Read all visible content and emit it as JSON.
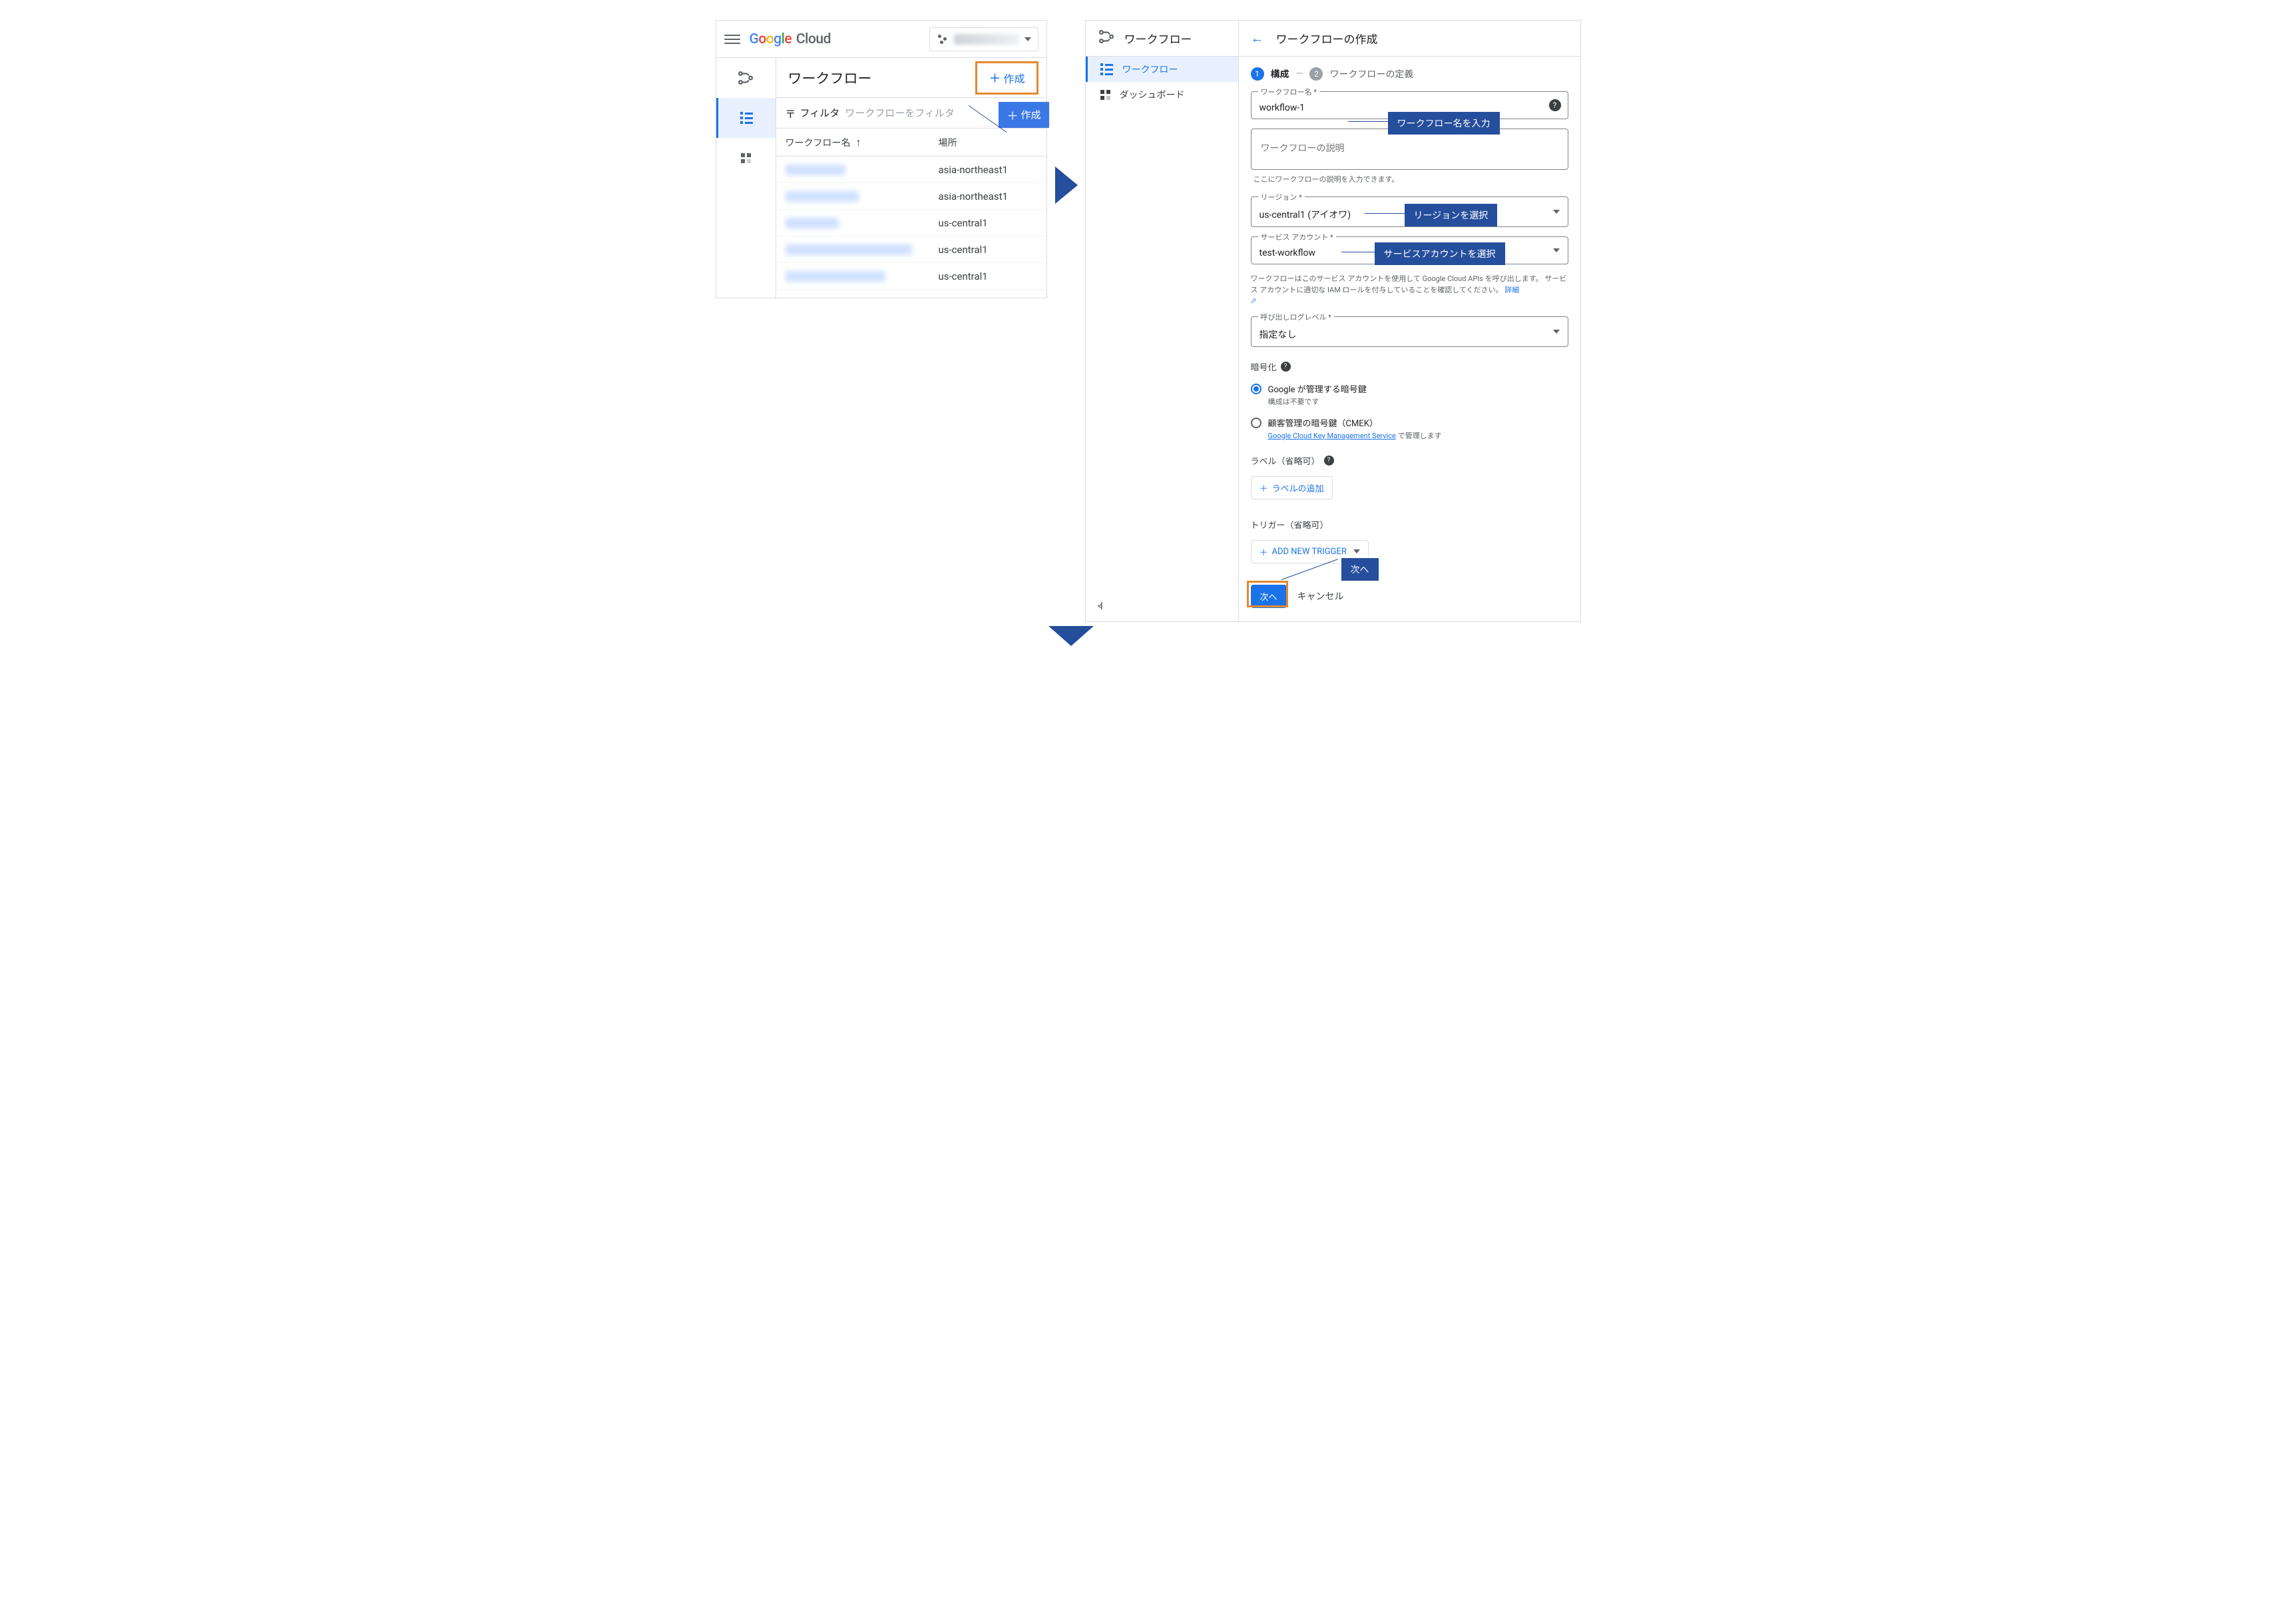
{
  "left": {
    "logoCloud": "Cloud",
    "title": "ワークフロー",
    "createLabel": "作成",
    "filterLabel": "フィルタ",
    "filterPlaceholder": "ワークフローをフィルタ",
    "tooltipCreate": "作成",
    "cols": {
      "name": "ワークフロー名",
      "loc": "場所"
    },
    "rows": [
      {
        "loc": "asia-northeast1"
      },
      {
        "loc": "asia-northeast1"
      },
      {
        "loc": "us-central1"
      },
      {
        "loc": "us-central1"
      },
      {
        "loc": "us-central1"
      }
    ]
  },
  "right": {
    "sideTitle": "ワークフロー",
    "nav": {
      "workflows": "ワークフロー",
      "dashboard": "ダッシュボード"
    },
    "headTitle": "ワークフローの作成",
    "step1": "構成",
    "step2": "ワークフローの定義",
    "fields": {
      "nameLegend": "ワークフロー名 *",
      "nameValue": "workflow-1",
      "descPlaceholder": "ワークフローの説明",
      "descHelper": "ここにワークフローの説明を入力できます。",
      "regionLegend": "リージョン *",
      "regionValue": "us-central1 (アイオワ)",
      "svcLegend": "サービス アカウント *",
      "svcValue": "test-workflow",
      "svcHelp1": "ワークフローはこのサービス アカウントを使用して Google Cloud APIs を呼び出します。",
      "svcHelp2": "サービス アカウントに適切な IAM ロールを付与していることを確認してください。",
      "svcDetail": "詳細",
      "logLegend": "呼び出しログレベル *",
      "logValue": "指定なし"
    },
    "enc": {
      "title": "暗号化",
      "opt1": "Google が管理する暗号鍵",
      "opt1sub": "構成は不要です",
      "opt2": "顧客管理の暗号鍵（CMEK）",
      "opt2link": "Google Cloud Key Management Service",
      "opt2tail": " で管理します"
    },
    "labelsTitle": "ラベル（省略可）",
    "labelsBtn": "ラベルの追加",
    "triggerTitle": "トリガー（省略可）",
    "triggerBtn": "ADD NEW TRIGGER",
    "next": "次へ",
    "cancel": "キャンセル"
  },
  "annot": {
    "name": "ワークフロー名を入力",
    "region": "リージョンを選択",
    "svc": "サービスアカウントを選択",
    "next": "次へ"
  }
}
